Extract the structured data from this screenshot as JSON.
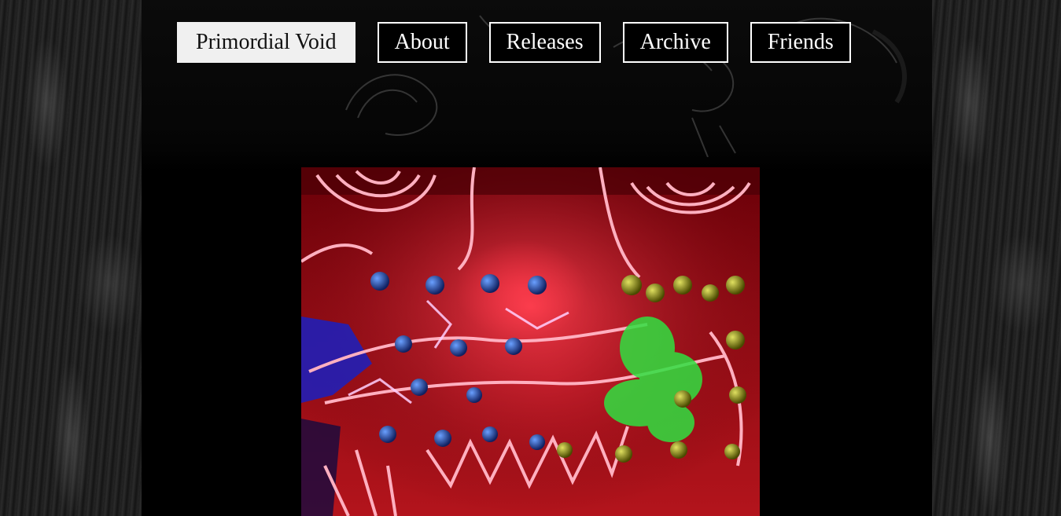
{
  "nav": {
    "items": [
      {
        "label": "Primordial Void",
        "active": true
      },
      {
        "label": "About",
        "active": false
      },
      {
        "label": "Releases",
        "active": false
      },
      {
        "label": "Archive",
        "active": false
      },
      {
        "label": "Friends",
        "active": false
      }
    ]
  },
  "colors": {
    "background": "#000000",
    "nav_active_bg": "#f0f0f0",
    "nav_border": "#ffffff",
    "art_red": "#c0121e"
  },
  "main": {
    "artwork_icon": "psychedelic-face-artwork"
  }
}
